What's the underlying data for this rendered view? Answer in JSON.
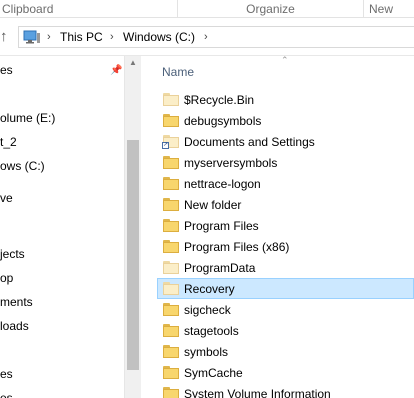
{
  "ribbon": {
    "groups": [
      "Clipboard",
      "Organize",
      "New"
    ]
  },
  "address": {
    "breadcrumbs": [
      "This PC",
      "Windows (C:)"
    ]
  },
  "nav": {
    "items": [
      "es",
      "olume (E:)",
      "t_2",
      "ows (C:)",
      "ve",
      "jects",
      "op",
      "ments",
      "loads",
      "es",
      "es"
    ]
  },
  "content": {
    "column_header": "Name",
    "selected_item": "Recovery",
    "items": [
      {
        "name": "$Recycle.Bin",
        "icon": "folder-icon"
      },
      {
        "name": "debugsymbols",
        "icon": "folder-icon"
      },
      {
        "name": "Documents and Settings",
        "icon": "shortcut-folder-icon"
      },
      {
        "name": "myserversymbols",
        "icon": "folder-icon"
      },
      {
        "name": "nettrace-logon",
        "icon": "folder-icon"
      },
      {
        "name": "New folder",
        "icon": "folder-icon"
      },
      {
        "name": "Program Files",
        "icon": "folder-icon"
      },
      {
        "name": "Program Files (x86)",
        "icon": "folder-icon"
      },
      {
        "name": "ProgramData",
        "icon": "folder-icon"
      },
      {
        "name": "Recovery",
        "icon": "folder-icon"
      },
      {
        "name": "sigcheck",
        "icon": "folder-icon"
      },
      {
        "name": "stagetools",
        "icon": "folder-icon"
      },
      {
        "name": "symbols",
        "icon": "folder-icon"
      },
      {
        "name": "SymCache",
        "icon": "folder-icon"
      },
      {
        "name": "System Volume Information",
        "icon": "folder-icon"
      }
    ]
  },
  "colors": {
    "selection_bg": "#cce8ff",
    "selection_border": "#99d1ff",
    "folder_yellow": "#f8d66d",
    "header_text": "#4c607a"
  }
}
